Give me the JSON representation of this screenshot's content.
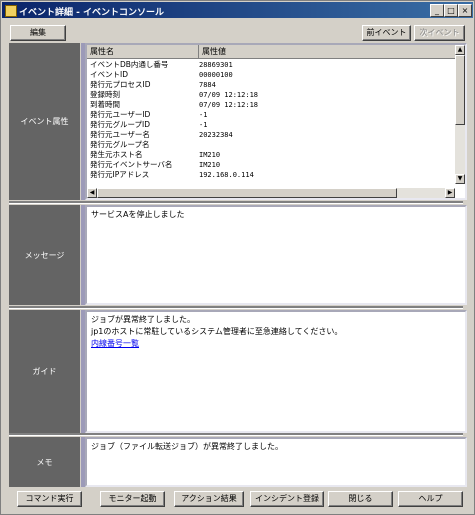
{
  "window": {
    "title": "イベント詳細 - イベントコンソール",
    "controls": {
      "minimize": "_",
      "maximize": "□",
      "close": "×"
    }
  },
  "toolbar": {
    "edit": "編集",
    "prev_event": "前イベント",
    "next_event": "次イベント"
  },
  "sections": {
    "attributes_label": "イベント属性",
    "message_label": "メッセージ",
    "guide_label": "ガイド",
    "memo_label": "メモ"
  },
  "attributes": {
    "headers": {
      "name": "属性名",
      "value": "属性値"
    },
    "rows": [
      {
        "name": "イベントDB内通し番号",
        "value": "28869301"
      },
      {
        "name": "イベントID",
        "value": "00000100"
      },
      {
        "name": "発行元プロセスID",
        "value": "7884"
      },
      {
        "name": "登録時刻",
        "value": "07/09 12:12:18"
      },
      {
        "name": "到着時間",
        "value": "07/09 12:12:18"
      },
      {
        "name": "発行元ユーザーID",
        "value": "-1"
      },
      {
        "name": "発行元グループID",
        "value": "-1"
      },
      {
        "name": "発行元ユーザー名",
        "value": "20232384"
      },
      {
        "name": "発行元グループ名",
        "value": ""
      },
      {
        "name": "発生元ホスト名",
        "value": "IM210"
      },
      {
        "name": "発行元イベントサーバ名",
        "value": "IM210"
      },
      {
        "name": "発行元IPアドレス",
        "value": "192.168.0.114"
      }
    ]
  },
  "message": {
    "text": "サービスAを停止しました"
  },
  "guide": {
    "line1": "ジョブが異常終了しました。",
    "line2": "jp1のホストに常駐しているシステム管理者に至急連絡してください。",
    "link": "内線番号一覧"
  },
  "memo": {
    "text": "ジョブ（ファイル転送ジョブ）が異常終了しました。"
  },
  "footer": {
    "command": "コマンド実行",
    "monitor": "モニター起動",
    "action": "アクション結果",
    "incident": "インシデント登録",
    "close": "閉じる",
    "help": "ヘルプ"
  }
}
